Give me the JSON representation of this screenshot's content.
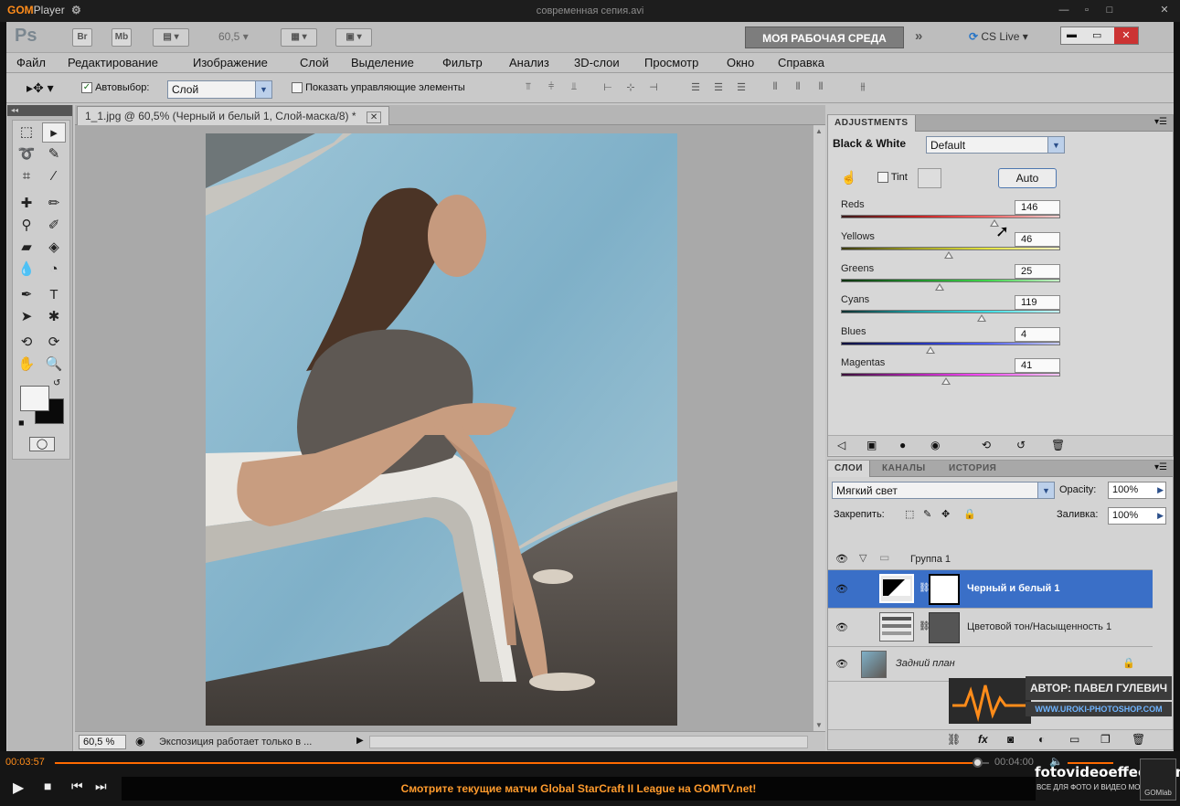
{
  "gom": {
    "brand_gom": "GOM",
    "brand_player": "Player",
    "file_title": "современная сепия.avi",
    "time_current": "00:03:57",
    "time_total": "00:04:00",
    "ticker": "Смотрите текущие матчи Global StarCraft II League на GOMTV.net!",
    "watermark": "fotovideoeffect.com",
    "watermark_sub": "ВСЕ ДЛЯ ФОТО И ВИДЕО МОНТАЖА",
    "gomlab": "GOMlab",
    "progress_fraction": 0.988
  },
  "ps": {
    "logo": "Ps",
    "br": "Br",
    "mb": "Mb",
    "zoom": "60,5",
    "workspace": "МОЯ РАБОЧАЯ СРЕДА",
    "cslive": "CS Live",
    "menu": [
      "Файл",
      "Редактирование",
      "Изображение",
      "Слой",
      "Выделение",
      "Фильтр",
      "Анализ",
      "3D-слои",
      "Просмотр",
      "Окно",
      "Справка"
    ],
    "options": {
      "autoselect_label": "Автовыбор:",
      "autoselect_value": "Слой",
      "show_controls": "Показать управляющие элементы"
    },
    "doc_tab": "1_1.jpg @ 60,5% (Черный и белый 1, Слой-маска/8) *",
    "status_zoom": "60,5 %",
    "status_msg": "Экспозиция работает только в ..."
  },
  "adjustments": {
    "tabs": [
      "ADJUSTMENTS"
    ],
    "title": "Black & White",
    "preset": "Default",
    "tint_label": "Tint",
    "auto_label": "Auto",
    "sliders": [
      {
        "label": "Reds",
        "value": "146",
        "pos": 0.7
      },
      {
        "label": "Yellows",
        "value": "46",
        "pos": 0.49
      },
      {
        "label": "Greens",
        "value": "25",
        "pos": 0.45
      },
      {
        "label": "Cyans",
        "value": "119",
        "pos": 0.64
      },
      {
        "label": "Blues",
        "value": "4",
        "pos": 0.41
      },
      {
        "label": "Magentas",
        "value": "41",
        "pos": 0.48
      }
    ]
  },
  "layers": {
    "tabs": [
      "СЛОИ",
      "КАНАЛЫ",
      "ИСТОРИЯ"
    ],
    "blend_mode": "Мягкий свет",
    "opacity_label": "Opacity:",
    "opacity_value": "100%",
    "lock_label": "Закрепить:",
    "fill_label": "Заливка:",
    "fill_value": "100%",
    "group_name": "Группа 1",
    "layer_bw": "Черный и белый 1",
    "layer_hue": "Цветовой тон/Насыщенность 1",
    "layer_bg": "Задний план",
    "author": "АВТОР: ПАВЕЛ ГУЛЕВИЧ",
    "site": "WWW.UROKI-PHOTOSHOP.COM"
  },
  "colors": {
    "accent_orange": "#ff8c1a",
    "layer_selected": "#3a6fc7"
  }
}
